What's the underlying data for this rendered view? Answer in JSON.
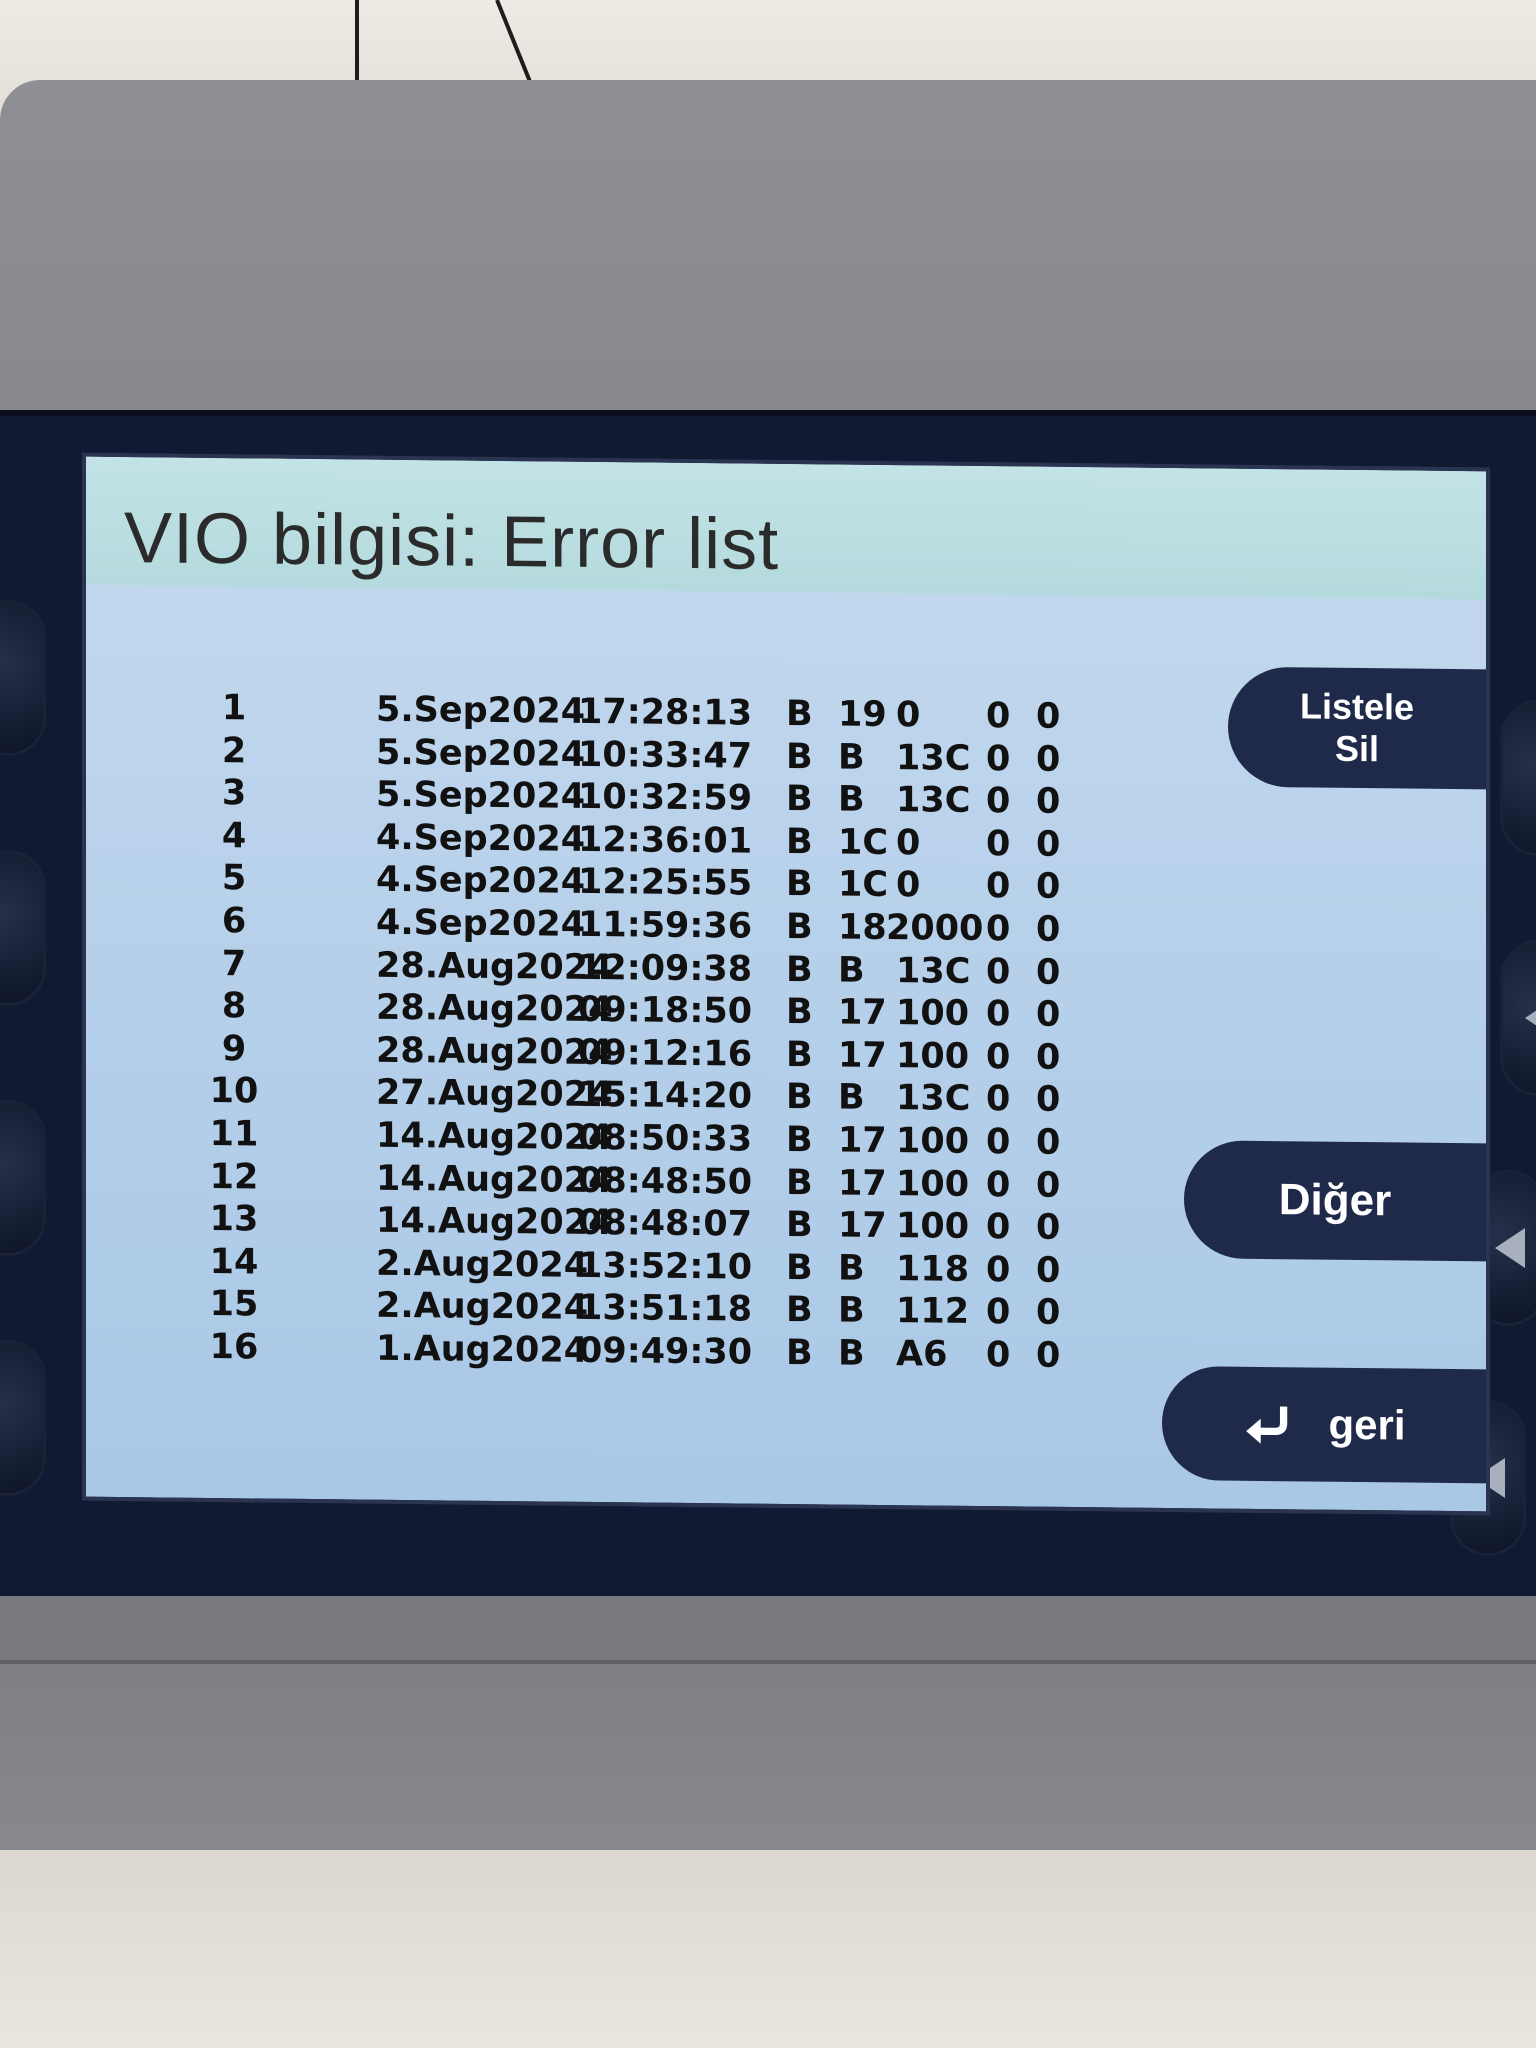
{
  "screen": {
    "title": "VIO bilgisi: Error list"
  },
  "softkeys": {
    "list_line1": "Listele",
    "list_line2": "Sil",
    "other": "Diğer",
    "back": "geri"
  },
  "icons": {
    "back": "return-arrow-icon",
    "side_buttons": "triangle-left-icon"
  },
  "error_list": [
    {
      "n": "1",
      "date": "5.Sep2024",
      "time": "17:28:13",
      "codes": [
        "B",
        "19",
        "0",
        "0",
        "0"
      ]
    },
    {
      "n": "2",
      "date": "5.Sep2024",
      "time": "10:33:47",
      "codes": [
        "B",
        "B",
        "13C",
        "0",
        "0"
      ]
    },
    {
      "n": "3",
      "date": "5.Sep2024",
      "time": "10:32:59",
      "codes": [
        "B",
        "B",
        "13C",
        "0",
        "0"
      ]
    },
    {
      "n": "4",
      "date": "4.Sep2024",
      "time": "12:36:01",
      "codes": [
        "B",
        "1C",
        "0",
        "0",
        "0"
      ]
    },
    {
      "n": "5",
      "date": "4.Sep2024",
      "time": "12:25:55",
      "codes": [
        "B",
        "1C",
        "0",
        "0",
        "0"
      ]
    },
    {
      "n": "6",
      "date": "4.Sep2024",
      "time": "11:59:36",
      "codes": [
        "B",
        "18",
        "2000",
        "0",
        "0"
      ]
    },
    {
      "n": "7",
      "date": "28.Aug2024",
      "time": "12:09:38",
      "codes": [
        "B",
        "B",
        "13C",
        "0",
        "0"
      ]
    },
    {
      "n": "8",
      "date": "28.Aug2024",
      "time": "09:18:50",
      "codes": [
        "B",
        "17",
        "100",
        "0",
        "0"
      ]
    },
    {
      "n": "9",
      "date": "28.Aug2024",
      "time": "09:12:16",
      "codes": [
        "B",
        "17",
        "100",
        "0",
        "0"
      ]
    },
    {
      "n": "10",
      "date": "27.Aug2024",
      "time": "15:14:20",
      "codes": [
        "B",
        "B",
        "13C",
        "0",
        "0"
      ]
    },
    {
      "n": "11",
      "date": "14.Aug2024",
      "time": "08:50:33",
      "codes": [
        "B",
        "17",
        "100",
        "0",
        "0"
      ]
    },
    {
      "n": "12",
      "date": "14.Aug2024",
      "time": "08:48:50",
      "codes": [
        "B",
        "17",
        "100",
        "0",
        "0"
      ]
    },
    {
      "n": "13",
      "date": "14.Aug2024",
      "time": "08:48:07",
      "codes": [
        "B",
        "17",
        "100",
        "0",
        "0"
      ]
    },
    {
      "n": "14",
      "date": "2.Aug2024",
      "time": "13:52:10",
      "codes": [
        "B",
        "B",
        "118",
        "0",
        "0"
      ]
    },
    {
      "n": "15",
      "date": "2.Aug2024",
      "time": "13:51:18",
      "codes": [
        "B",
        "B",
        "112",
        "0",
        "0"
      ]
    },
    {
      "n": "16",
      "date": "1.Aug2024",
      "time": "09:49:30",
      "codes": [
        "B",
        "B",
        "A6",
        "0",
        "0"
      ]
    }
  ]
}
